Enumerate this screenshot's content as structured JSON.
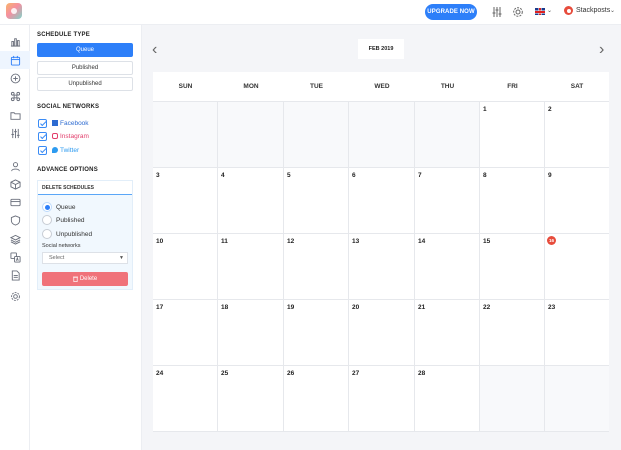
{
  "header": {
    "upgrade_label": "UPGRADE NOW",
    "user_name": "Stackposts",
    "language_flag": "uk-flag"
  },
  "rail": {
    "icons": [
      "bar-chart-icon",
      "calendar-icon",
      "plus-circle-icon",
      "command-icon",
      "folder-icon",
      "sliders-icon",
      "user-icon",
      "box-icon",
      "credit-card-icon",
      "shield-icon",
      "layers-icon",
      "translate-icon",
      "file-icon",
      "gear-icon"
    ],
    "active_index": 1
  },
  "sidebar": {
    "schedule_type_title": "SCHEDULE TYPE",
    "types": [
      {
        "label": "Queue",
        "active": true
      },
      {
        "label": "Published",
        "active": false
      },
      {
        "label": "Unpublished",
        "active": false
      }
    ],
    "social_title": "SOCIAL NETWORKS",
    "networks": [
      {
        "label": "Facebook",
        "checked": true,
        "color": "#2d6bd1",
        "icon": "facebook-icon"
      },
      {
        "label": "Instagram",
        "checked": true,
        "color": "#e23d6b",
        "icon": "instagram-icon"
      },
      {
        "label": "Twitter",
        "checked": true,
        "color": "#2d9bf0",
        "icon": "twitter-icon"
      }
    ],
    "advance_title": "ADVANCE OPTIONS",
    "advance": {
      "header": "DELETE SCHEDULES",
      "options": [
        {
          "label": "Queue",
          "selected": true
        },
        {
          "label": "Published",
          "selected": false
        },
        {
          "label": "Unpublished",
          "selected": false
        }
      ],
      "social_label": "Social networks",
      "select_value": "Select",
      "delete_label": "Delete"
    }
  },
  "calendar": {
    "month_label": "FEB 2019",
    "days": [
      "SUN",
      "MON",
      "TUE",
      "WED",
      "THU",
      "FRI",
      "SAT"
    ],
    "weeks": [
      [
        "",
        "",
        "",
        "",
        "",
        "1",
        "2"
      ],
      [
        "3",
        "4",
        "5",
        "6",
        "7",
        "8",
        "9"
      ],
      [
        "10",
        "11",
        "12",
        "13",
        "14",
        "15",
        "16"
      ],
      [
        "17",
        "18",
        "19",
        "20",
        "21",
        "22",
        "23"
      ],
      [
        "24",
        "25",
        "26",
        "27",
        "28",
        "",
        ""
      ]
    ],
    "today": "16",
    "accent_color": "#2d7ff9",
    "today_color": "#e74c3c"
  }
}
